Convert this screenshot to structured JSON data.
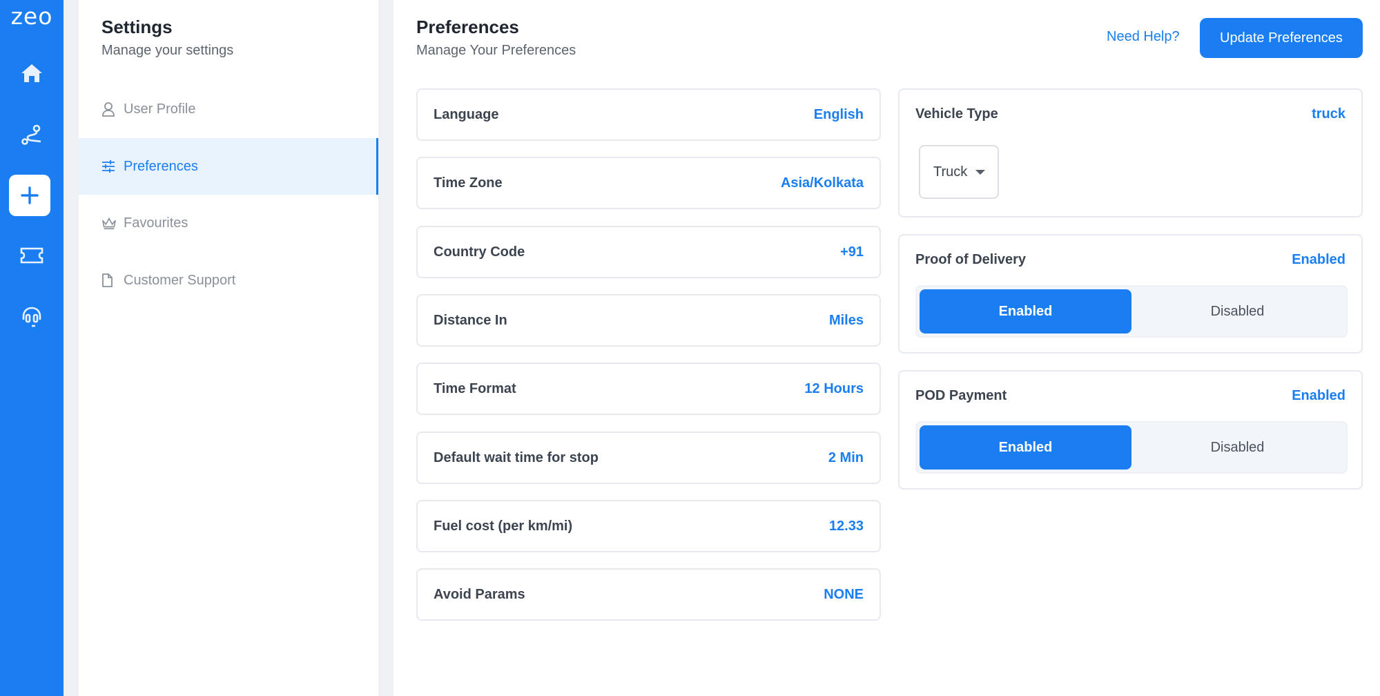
{
  "app": {
    "logo_text": "zeo",
    "brand_color": "#1a7ef2"
  },
  "rail": {
    "items": [
      {
        "icon": "home-icon"
      },
      {
        "icon": "route-icon"
      },
      {
        "icon": "plus-icon"
      },
      {
        "icon": "ticket-icon"
      },
      {
        "icon": "headset-icon"
      }
    ]
  },
  "settings": {
    "title": "Settings",
    "subtitle": "Manage your settings",
    "nav": [
      {
        "label": "User Profile",
        "icon": "user-icon",
        "active": false
      },
      {
        "label": "Preferences",
        "icon": "sliders-icon",
        "active": true
      },
      {
        "label": "Favourites",
        "icon": "crown-icon",
        "active": false
      },
      {
        "label": "Customer Support",
        "icon": "document-icon",
        "active": false
      }
    ]
  },
  "header": {
    "title": "Preferences",
    "subtitle": "Manage Your Preferences",
    "help_label": "Need Help?",
    "update_label": "Update Preferences"
  },
  "preferences": [
    {
      "label": "Language",
      "value": "English"
    },
    {
      "label": "Time Zone",
      "value": "Asia/Kolkata"
    },
    {
      "label": "Country Code",
      "value": "+91"
    },
    {
      "label": "Distance In",
      "value": "Miles"
    },
    {
      "label": "Time Format",
      "value": "12 Hours"
    },
    {
      "label": "Default wait time for stop",
      "value": "2 Min"
    },
    {
      "label": "Fuel cost (per km/mi)",
      "value": "12.33"
    },
    {
      "label": "Avoid Params",
      "value": "NONE"
    }
  ],
  "vehicle": {
    "label": "Vehicle Type",
    "value": "truck",
    "selected": "Truck"
  },
  "proof_of_delivery": {
    "label": "Proof of Delivery",
    "value": "Enabled",
    "on_label": "Enabled",
    "off_label": "Disabled"
  },
  "pod_payment": {
    "label": "POD Payment",
    "value": "Enabled",
    "on_label": "Enabled",
    "off_label": "Disabled"
  }
}
